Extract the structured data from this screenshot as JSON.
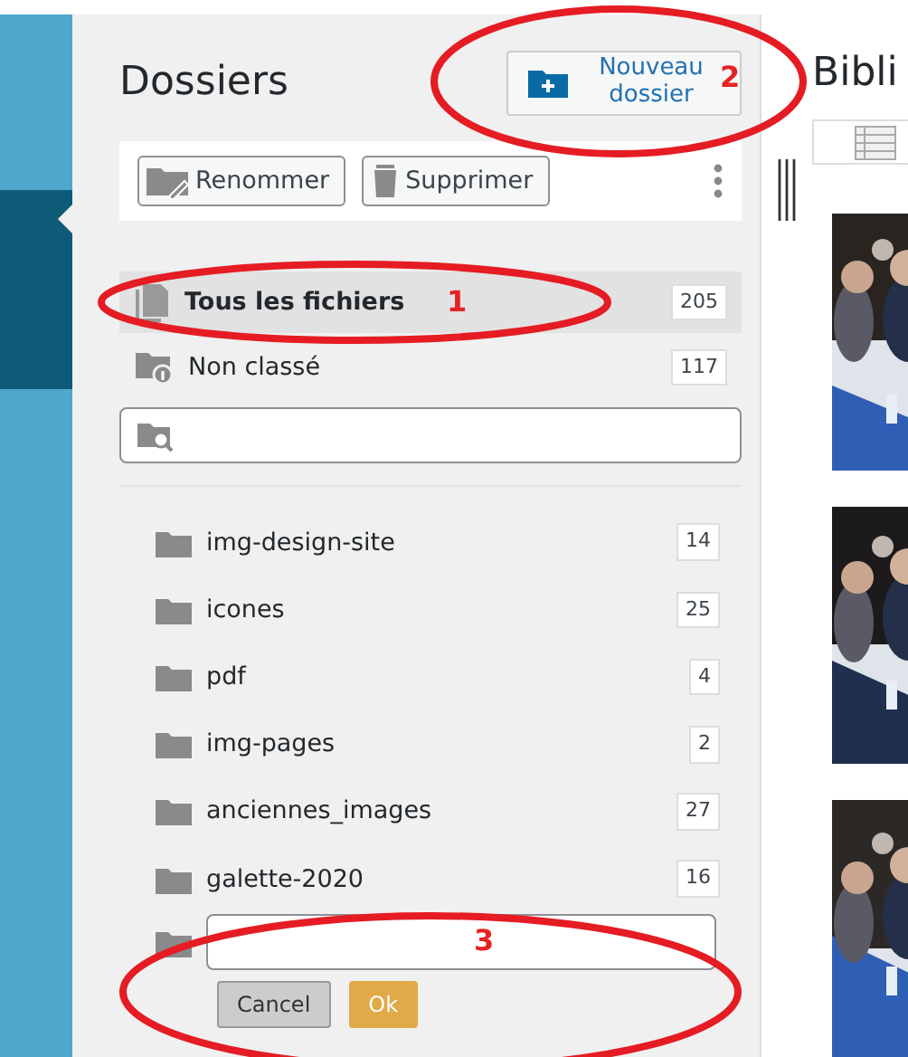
{
  "panel": {
    "title": "Dossiers",
    "new_button": "Nouveau dossier"
  },
  "toolbar": [
    {
      "label": "Renommer",
      "kind": "rename"
    },
    {
      "label": "Supprimer",
      "kind": "delete"
    }
  ],
  "special_items": [
    {
      "label": "Tous les fichiers",
      "count": "205",
      "selected": true,
      "kind": "all"
    },
    {
      "label": "Non classé",
      "count": "117",
      "selected": false,
      "kind": "unclassified"
    }
  ],
  "folders": [
    {
      "label": "img-design-site",
      "count": "14"
    },
    {
      "label": "icones",
      "count": "25"
    },
    {
      "label": "pdf",
      "count": "4"
    },
    {
      "label": "img-pages",
      "count": "2"
    },
    {
      "label": "anciennes_images",
      "count": "27"
    },
    {
      "label": "galette-2020",
      "count": "16"
    }
  ],
  "new_folder": {
    "buttons": [
      {
        "label": "Cancel",
        "kind": "cancel"
      },
      {
        "label": "Ok",
        "kind": "ok"
      }
    ]
  },
  "library": {
    "title": "Bibli"
  },
  "annotations": [
    {
      "label": "1"
    },
    {
      "label": "2"
    },
    {
      "label": "3"
    }
  ]
}
